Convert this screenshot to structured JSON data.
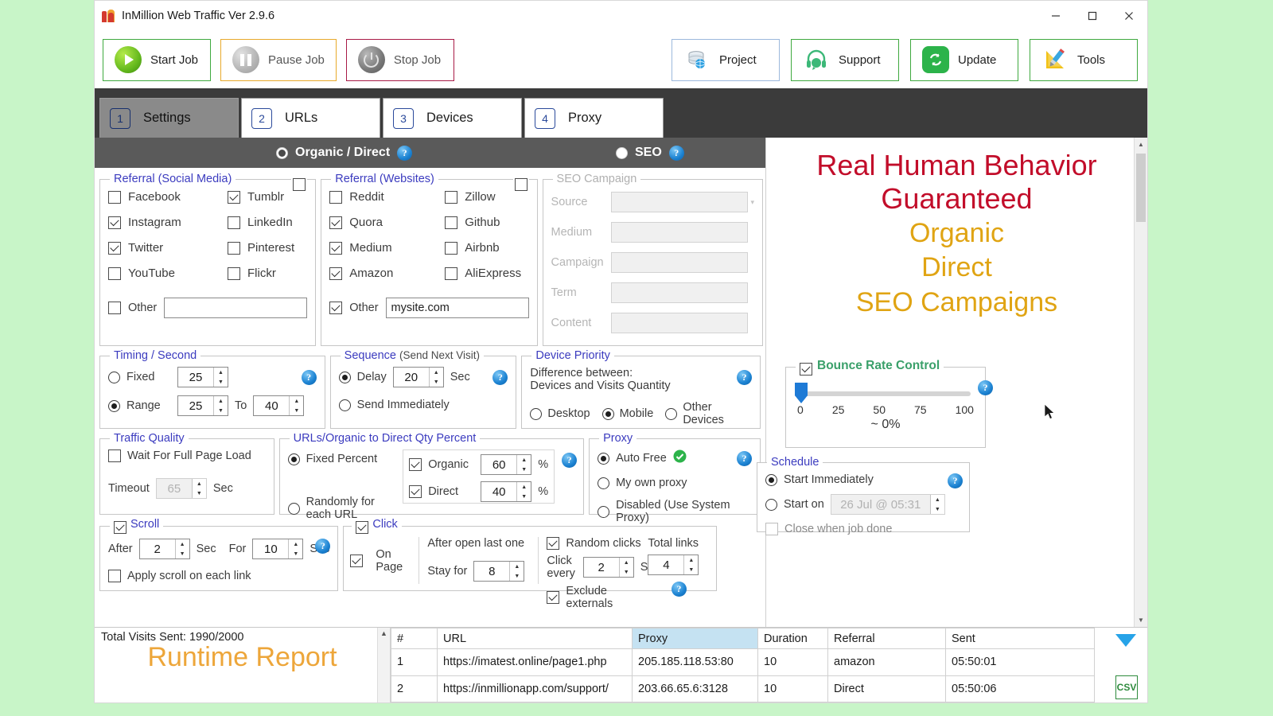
{
  "window": {
    "title": "InMillion Web Traffic Ver 2.9.6",
    "minimize": "—",
    "maximize": "□",
    "close": "✕"
  },
  "toolbar": {
    "start": "Start Job",
    "pause": "Pause Job",
    "stop": "Stop Job",
    "project": "Project",
    "support": "Support",
    "update": "Update",
    "tools": "Tools"
  },
  "tabs": [
    {
      "num": "1",
      "label": "Settings",
      "active": true
    },
    {
      "num": "2",
      "label": "URLs",
      "active": false
    },
    {
      "num": "3",
      "label": "Devices",
      "active": false
    },
    {
      "num": "4",
      "label": "Proxy",
      "active": false
    }
  ],
  "mode": {
    "organic_label": "Organic / Direct",
    "organic_selected": true,
    "seo_label": "SEO",
    "seo_selected": false,
    "help": "?"
  },
  "social": {
    "legend": "Referral (Social Media)",
    "group_checked": false,
    "items": [
      {
        "label": "Facebook",
        "checked": false
      },
      {
        "label": "Tumblr",
        "checked": true
      },
      {
        "label": "Instagram",
        "checked": true
      },
      {
        "label": "LinkedIn",
        "checked": false
      },
      {
        "label": "Twitter",
        "checked": true
      },
      {
        "label": "Pinterest",
        "checked": false
      },
      {
        "label": "YouTube",
        "checked": false
      },
      {
        "label": "Flickr",
        "checked": false
      }
    ],
    "other_label": "Other",
    "other_checked": false,
    "other_value": ""
  },
  "websites": {
    "legend": "Referral (Websites)",
    "group_checked": false,
    "items": [
      {
        "label": "Reddit",
        "checked": false
      },
      {
        "label": "Zillow",
        "checked": false
      },
      {
        "label": "Quora",
        "checked": true
      },
      {
        "label": "Github",
        "checked": false
      },
      {
        "label": "Medium",
        "checked": true
      },
      {
        "label": "Airbnb",
        "checked": false
      },
      {
        "label": "Amazon",
        "checked": true
      },
      {
        "label": "AliExpress",
        "checked": false
      }
    ],
    "other_label": "Other",
    "other_checked": true,
    "other_value": "mysite.com"
  },
  "seo_campaign": {
    "legend": "SEO Campaign",
    "fields": [
      {
        "label": "Source",
        "value": ""
      },
      {
        "label": "Medium",
        "value": ""
      },
      {
        "label": "Campaign",
        "value": ""
      },
      {
        "label": "Term",
        "value": ""
      },
      {
        "label": "Content",
        "value": ""
      }
    ]
  },
  "timing": {
    "legend": "Timing / Second",
    "fixed_label": "Fixed",
    "fixed_selected": false,
    "fixed_value": "25",
    "range_label": "Range",
    "range_selected": true,
    "range_from": "25",
    "to_label": "To",
    "range_to": "40"
  },
  "sequence": {
    "legend": "Sequence",
    "legend_note": "(Send Next Visit)",
    "delay_label": "Delay",
    "delay_selected": true,
    "delay_value": "20",
    "sec_label": "Sec",
    "immediate_label": "Send Immediately",
    "immediate_selected": false
  },
  "device_priority": {
    "legend": "Device Priority",
    "note_line1": "Difference between:",
    "note_line2": "Devices and Visits Quantity",
    "options": [
      {
        "label": "Desktop",
        "selected": false
      },
      {
        "label": "Mobile",
        "selected": true
      },
      {
        "label": "Other Devices",
        "selected": false
      }
    ]
  },
  "bounce": {
    "legend": "Bounce Rate Control",
    "checked": true,
    "ticks": [
      "0",
      "25",
      "50",
      "75",
      "100"
    ],
    "value": 0,
    "value_label": "~ 0%"
  },
  "traffic_quality": {
    "legend": "Traffic Quality",
    "wait_label": "Wait For Full Page Load",
    "wait_checked": false,
    "timeout_label": "Timeout",
    "timeout_value": "65",
    "sec_label": "Sec"
  },
  "qty_percent": {
    "legend": "URLs/Organic to Direct Qty Percent",
    "fixed_label": "Fixed Percent",
    "fixed_selected": true,
    "random_label": "Randomly for each URL",
    "random_selected": false,
    "organic_label": "Organic",
    "organic_checked": true,
    "organic_value": "60",
    "direct_label": "Direct",
    "direct_checked": true,
    "direct_value": "40",
    "percent_sign": "%"
  },
  "proxy": {
    "legend": "Proxy",
    "options": [
      {
        "label": "Auto Free",
        "selected": true,
        "ok": true
      },
      {
        "label": "My own proxy",
        "selected": false,
        "ok": false
      },
      {
        "label": "Disabled (Use System Proxy)",
        "selected": false,
        "ok": false
      }
    ]
  },
  "schedule": {
    "legend": "Schedule",
    "immediate_label": "Start Immediately",
    "immediate_selected": true,
    "start_on_label": "Start on",
    "start_on_selected": false,
    "start_on_value": "26  Jul   @ 05:31",
    "close_label": "Close when job done",
    "close_checked": false
  },
  "scroll": {
    "legend": "Scroll",
    "checked": true,
    "after_label": "After",
    "after_value": "2",
    "sec_label": "Sec",
    "for_label": "For",
    "for_value": "10",
    "sec_label2": "Sec",
    "apply_label": "Apply scroll on each link",
    "apply_checked": false
  },
  "click": {
    "legend": "Click",
    "checked": true,
    "on_page_label": "On Page",
    "on_page_checked": true,
    "after_open_label": "After open last one",
    "stay_for_label": "Stay for",
    "stay_for_value": "8",
    "random_label": "Random clicks",
    "random_checked": true,
    "click_every_label": "Click every",
    "click_every_value": "2",
    "click_every_unit": "S",
    "total_links_label": "Total links",
    "total_links_value": "4",
    "exclude_label": "Exclude externals",
    "exclude_checked": true
  },
  "promo": {
    "line1": "Real Human Behavior",
    "line2": "Guaranteed",
    "line3": "Organic",
    "line4": "Direct",
    "line5": "SEO Campaigns"
  },
  "report": {
    "total_visits": "Total Visits Sent: 1990/2000",
    "heading": "Runtime Report",
    "columns": [
      "#",
      "URL",
      "Proxy",
      "Duration",
      "Referral",
      "Sent"
    ],
    "highlight_column": "Proxy",
    "rows": [
      {
        "num": "1",
        "url": "https://imatest.online/page1.php",
        "proxy": "205.185.118.53:80",
        "duration": "10",
        "referral": "amazon",
        "sent": "05:50:01"
      },
      {
        "num": "2",
        "url": "https://inmillionapp.com/support/",
        "proxy": "203.66.65.6:3128",
        "duration": "10",
        "referral": "Direct",
        "sent": "05:50:06"
      }
    ],
    "csv_label": "CSV"
  },
  "colors": {
    "accent_blue": "#3b3bbf",
    "promo_red": "#c20d2a",
    "promo_gold": "#e0a413",
    "bounce_green": "#3aa06a",
    "slider_blue": "#1e7ad6"
  }
}
